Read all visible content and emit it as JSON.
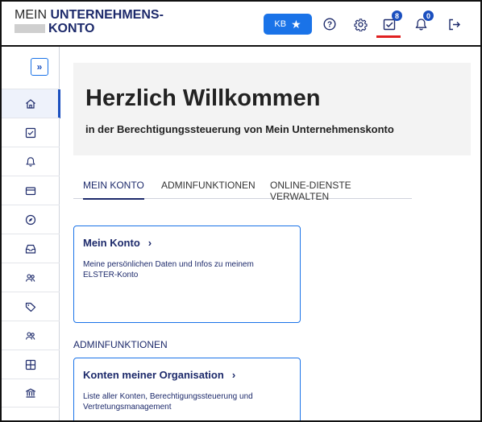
{
  "header": {
    "logo_line1_light": "MEIN",
    "logo_line1_bold": "UNTERNEHMENS-",
    "logo_line2_bold": "KONTO",
    "kb_label": "KB",
    "tasks_badge": "8",
    "notifications_badge": "0"
  },
  "sidebar": {
    "collapse_label": "»",
    "items": [
      {
        "icon": "home-icon"
      },
      {
        "icon": "checkbox-icon"
      },
      {
        "icon": "bell-icon"
      },
      {
        "icon": "card-icon"
      },
      {
        "icon": "compass-icon"
      },
      {
        "icon": "inbox-icon"
      },
      {
        "icon": "people-icon"
      },
      {
        "icon": "tag-icon"
      },
      {
        "icon": "group-icon"
      },
      {
        "icon": "grid-icon"
      },
      {
        "icon": "bank-icon"
      }
    ]
  },
  "hero": {
    "title": "Herzlich Willkommen",
    "subtitle": "in der Berechtigungssteuerung von Mein Unternehmenskonto"
  },
  "tabs": [
    "MEIN KONTO",
    "ADMINFUNKTIONEN",
    "ONLINE-DIENSTE VERWALTEN"
  ],
  "cards": {
    "mein_konto": {
      "title": "Mein Konto",
      "arrow": "›",
      "description": "Meine persönlichen Daten und Infos zu meinem ELSTER-Konto"
    },
    "section_label": "ADMINFUNKTIONEN",
    "organisation": {
      "title": "Konten meiner Organisation",
      "arrow": "›",
      "description": "Liste aller Konten, Berechtigungssteuerung und Vertretungsmanagement"
    }
  },
  "colors": {
    "accent": "#1a73e8",
    "brand_dark": "#1d2a6b",
    "indicator": "#e02020"
  }
}
